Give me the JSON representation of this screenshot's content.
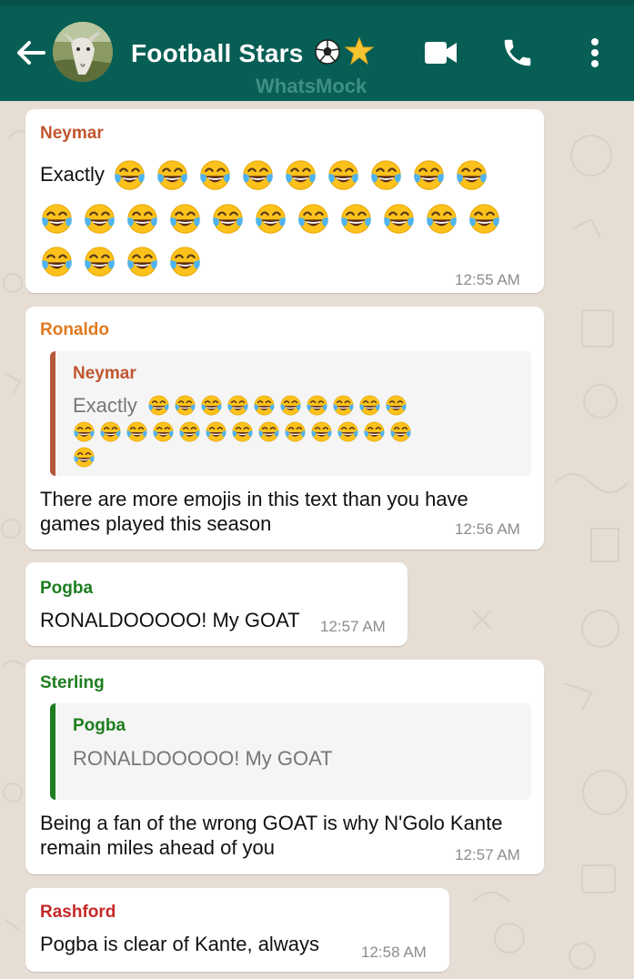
{
  "header": {
    "title": "Football Stars",
    "title_emojis": [
      "soccer-ball",
      "star"
    ],
    "watermark": "WhatsMock",
    "icons": [
      "back-arrow-icon",
      "video-call-icon",
      "phone-icon",
      "more-vert-icon"
    ],
    "bg_color": "#075e54"
  },
  "messages": [
    {
      "sender": "Neymar",
      "sender_color": "#c0562f",
      "text": "Exactly",
      "emoji": "tears-of-joy",
      "emoji_count": 24,
      "time": "12:55 AM"
    },
    {
      "sender": "Ronaldo",
      "sender_color": "#e07a1f",
      "quote": {
        "sender": "Neymar",
        "text": "Exactly",
        "emoji_count": 24
      },
      "text_line1": "There are more emojis in this text than you have",
      "text_line2": "games played this season",
      "time": "12:56 AM"
    },
    {
      "sender": "Pogba",
      "sender_color": "#1e7d1e",
      "text": "RONALDOOOOO! My GOAT",
      "time": "12:57 AM"
    },
    {
      "sender": "Sterling",
      "sender_color": "#1e7d1e",
      "quote": {
        "sender": "Pogba",
        "text": "RONALDOOOOO! My GOAT"
      },
      "text_line1": "Being a fan of the wrong GOAT is why N'Golo Kante",
      "text_line2": "remain miles ahead of you",
      "time": "12:57 AM"
    },
    {
      "sender": "Rashford",
      "sender_color": "#c62828",
      "text": "Pogba is clear of Kante, always",
      "time": "12:58 AM"
    }
  ]
}
